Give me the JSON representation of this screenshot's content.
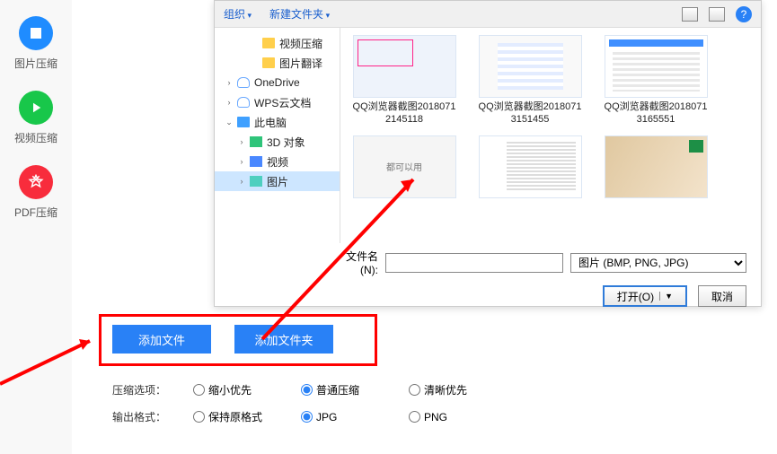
{
  "sidebar": {
    "items": [
      {
        "label": "图片压缩",
        "name": "image-compress"
      },
      {
        "label": "视频压缩",
        "name": "video-compress"
      },
      {
        "label": "PDF压缩",
        "name": "pdf-compress"
      }
    ]
  },
  "main": {
    "add_file": "添加文件",
    "add_folder": "添加文件夹",
    "compress_label": "压缩选项：",
    "compress_opts": [
      {
        "label": "缩小优先",
        "value": "shrink",
        "checked": false
      },
      {
        "label": "普通压缩",
        "value": "normal",
        "checked": true
      },
      {
        "label": "清晰优先",
        "value": "clear",
        "checked": false
      }
    ],
    "format_label": "输出格式：",
    "format_opts": [
      {
        "label": "保持原格式",
        "value": "keep",
        "checked": false
      },
      {
        "label": "JPG",
        "value": "jpg",
        "checked": true
      },
      {
        "label": "PNG",
        "value": "png",
        "checked": false
      }
    ]
  },
  "dialog": {
    "toolbar": {
      "organize": "组织",
      "new_folder": "新建文件夹"
    },
    "tree": [
      {
        "label": "视频压缩",
        "icon": "folder",
        "indent": 2,
        "caret": ""
      },
      {
        "label": "图片翻译",
        "icon": "folder",
        "indent": 2,
        "caret": ""
      },
      {
        "label": "OneDrive",
        "icon": "cloud",
        "indent": 0,
        "caret": "›"
      },
      {
        "label": "WPS云文档",
        "icon": "cloud",
        "indent": 0,
        "caret": "›"
      },
      {
        "label": "此电脑",
        "icon": "pc",
        "indent": 0,
        "caret": "⌄"
      },
      {
        "label": "3D 对象",
        "icon": "3d",
        "indent": 1,
        "caret": "›"
      },
      {
        "label": "视频",
        "icon": "vid",
        "indent": 1,
        "caret": "›"
      },
      {
        "label": "图片",
        "icon": "img",
        "indent": 1,
        "caret": "›",
        "selected": true
      }
    ],
    "files": [
      {
        "name": "QQ浏览器截图20180712145118",
        "thumb": "t1"
      },
      {
        "name": "QQ浏览器截图20180713151455",
        "thumb": "t2"
      },
      {
        "name": "QQ浏览器截图20180713165551",
        "thumb": "t3"
      },
      {
        "name": "",
        "thumb": "t4",
        "thumb_text": "都可以用"
      },
      {
        "name": "",
        "thumb": "t5"
      },
      {
        "name": "",
        "thumb": "t6"
      }
    ],
    "fn_label": "文件名(N):",
    "filter": "图片 (BMP, PNG, JPG)",
    "open": "打开(O)",
    "cancel": "取消"
  }
}
